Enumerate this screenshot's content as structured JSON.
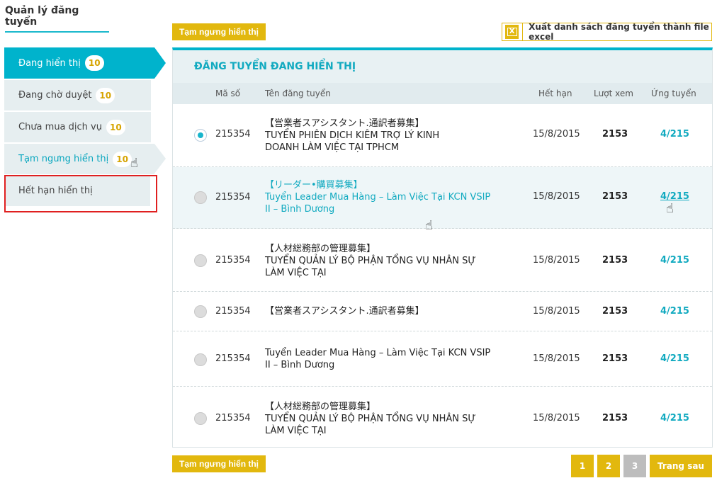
{
  "page_title": "Quản lý đăng tuyển",
  "sidebar": {
    "items": [
      {
        "label": "Đang hiển thị",
        "count": "10"
      },
      {
        "label": "Đang chờ duyệt",
        "count": "10"
      },
      {
        "label": "Chưa mua dịch vụ",
        "count": "10"
      },
      {
        "label": "Tạm ngưng hiển thị",
        "count": "10"
      },
      {
        "label": "Hết hạn hiển thị"
      }
    ]
  },
  "toolbar": {
    "suspend_label": "Tạm ngưng hiển thị",
    "export_label": "Xuất danh sách đăng tuyển thành file excel",
    "export_icon": "excel-icon"
  },
  "panel": {
    "heading": "ĐĂNG TUYỂN ĐANG HIỂN THỊ",
    "columns": {
      "code": "Mã số",
      "title": "Tên đăng tuyển",
      "expires": "Hết hạn",
      "views": "Lượt xem",
      "applications": "Ứng tuyển"
    },
    "rows": [
      {
        "code": "215354",
        "title_lines": [
          "【営業者スアシスタント.通訳者募集】",
          "TUYỂN PHIÊN DỊCH KIÊM TRỢ LÝ KINH",
          "DOANH LÀM VIỆC TẠI TPHCM"
        ],
        "expires": "15/8/2015",
        "views": "2153",
        "applications": "4/215"
      },
      {
        "code": "215354",
        "title_lines": [
          "【リーダー•購買募集】",
          "Tuyển Leader Mua Hàng – Làm Việc Tại KCN VSIP",
          "II – Bình Dương"
        ],
        "expires": "15/8/2015",
        "views": "2153",
        "applications": "4/215"
      },
      {
        "code": "215354",
        "title_lines": [
          "【人材総務部の管理募集】",
          "TUYỂN QUẢN LÝ BỘ PHẬN TỔNG VỤ NHÂN SỰ",
          "LÀM VIỆC TẠI"
        ],
        "expires": "15/8/2015",
        "views": "2153",
        "applications": "4/215"
      },
      {
        "code": "215354",
        "title_lines": [
          "【営業者スアシスタント.通訳者募集】"
        ],
        "expires": "15/8/2015",
        "views": "2153",
        "applications": "4/215"
      },
      {
        "code": "215354",
        "title_lines": [
          "Tuyển Leader Mua Hàng – Làm Việc Tại KCN VSIP",
          "II – Bình Dương"
        ],
        "expires": "15/8/2015",
        "views": "2153",
        "applications": "4/215"
      },
      {
        "code": "215354",
        "title_lines": [
          "【人材総務部の管理募集】",
          "TUYỂN QUẢN LÝ BỘ PHẬN TỔNG VỤ NHÂN SỰ",
          "LÀM VIỆC TẠI"
        ],
        "expires": "15/8/2015",
        "views": "2153",
        "applications": "4/215"
      }
    ]
  },
  "pagination": {
    "pages": [
      "1",
      "2",
      "3"
    ],
    "next_label": "Trang sau"
  },
  "colors": {
    "accent": "#00b3cc",
    "button": "#e2b80e",
    "highlight_box": "#e02020"
  }
}
